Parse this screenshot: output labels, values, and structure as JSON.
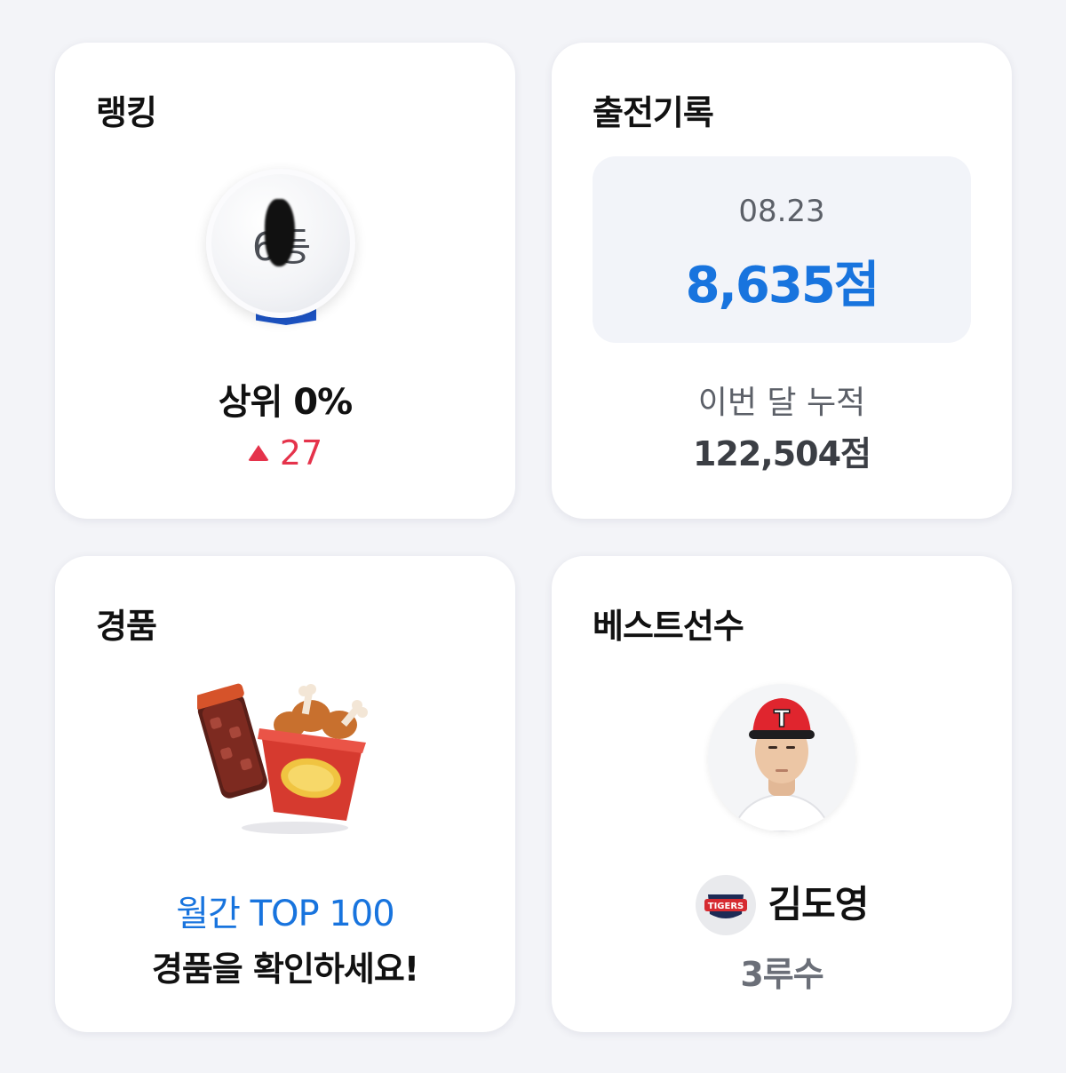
{
  "ranking": {
    "title": "랭킹",
    "rank_text": "6등",
    "percent_text": "상위 0%",
    "change": "27",
    "colors": {
      "ribbon": "#1d55c8",
      "change": "#e5334b"
    }
  },
  "attendance": {
    "title": "출전기록",
    "date": "08.23",
    "score": "8,635점",
    "month_label": "이번 달 누적",
    "month_total": "122,504점",
    "colors": {
      "score": "#1874de"
    }
  },
  "prize": {
    "title": "경품",
    "line1": "월간 TOP 100",
    "line2": "경품을 확인하세요!",
    "icon": "cola-and-chicken-bucket"
  },
  "best_player": {
    "title": "베스트선수",
    "name": "김도영",
    "position": "3루수",
    "team_logo_text": "TIGERS"
  }
}
